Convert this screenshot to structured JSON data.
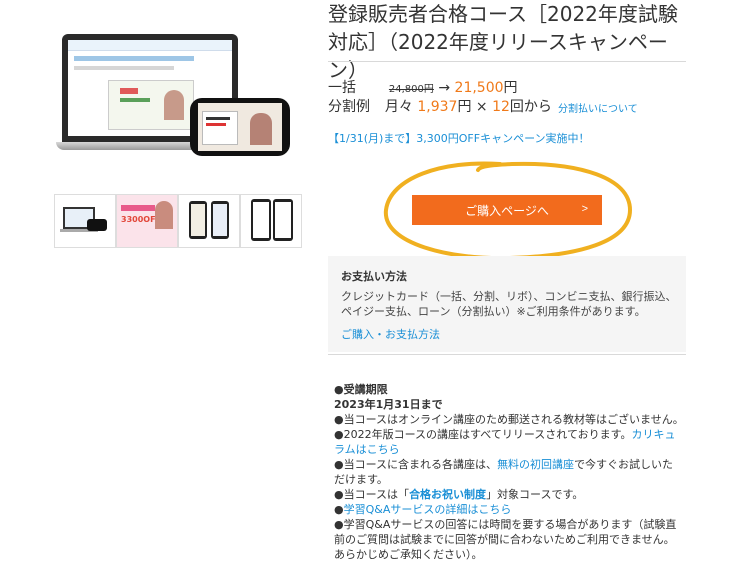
{
  "product": {
    "title": "登録販売者合格コース［2022年度試験対応］（2022年度リリースキャンペーン）",
    "hero_image_label": "合格コース 講座画面",
    "thumbnails": [
      {
        "name": "thumb-device-image"
      },
      {
        "name": "thumb-campaign-banner",
        "text": "3300OFF"
      },
      {
        "name": "thumb-phone-screens"
      },
      {
        "name": "thumb-phone-text"
      }
    ]
  },
  "pricing": {
    "lump_label": "一括",
    "lump_old": "24,800円",
    "arrow": "→",
    "lump_new": "21,500",
    "yen": "円",
    "split_label": "分割例",
    "monthly_prefix": "月々",
    "monthly_amount": "1,937",
    "times": "円 ×",
    "count": "12",
    "count_suffix": "回から",
    "split_link": "分割払いについて"
  },
  "campaign": "【1/31(月)まで】3,300円OFFキャンペーン実施中！",
  "buy_button": {
    "label": "ご購入ページへ",
    "arrow": ">"
  },
  "payment": {
    "heading": "お支払い方法",
    "text": "クレジットカード（一括、分割、リボ）、コンビニ支払、銀行振込、ペイジー支払、ローン（分割払い）※ご利用条件があります。",
    "link": "ご購入・お支払方法"
  },
  "notes": {
    "period_heading": "●受講期限",
    "period_date": "2023年1月31日まで",
    "line1": "●当コースはオンライン講座のため郵送される教材等はございません。",
    "line2_text": "●2022年版コースの講座はすべてリリースされております。",
    "line2_link": "カリキュラムはこちら",
    "line3_text": "●当コースに含まれる各講座は、",
    "line3_link": "無料の初回講座",
    "line3_rest": "で今すぐお試しいただけます。",
    "line4_prefix": "●当コースは「",
    "line4_link": "合格お祝い制度",
    "line4_suffix": "」対象コースです。",
    "line5_bullet": "●",
    "line5_link": "学習Q&Aサービスの詳細はこちら",
    "line6": "●学習Q&Aサービスの回答には時間を要する場合があります（試験直前のご質問は試験までに回答が間に合わないためご利用できません。あらかじめご承知ください）。"
  },
  "colors": {
    "accent": "#f26b1d",
    "link": "#1a8fd6",
    "highlight_circle": "#f0b020"
  }
}
